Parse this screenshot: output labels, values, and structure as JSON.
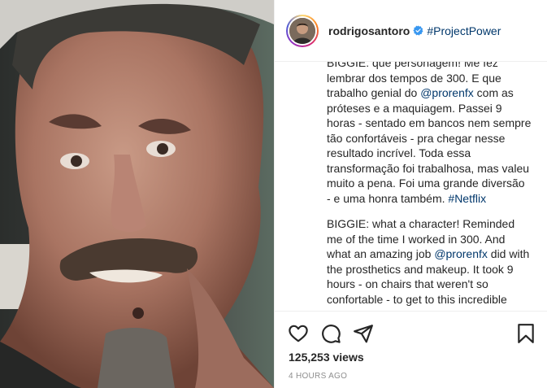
{
  "post": {
    "media_alt": "Close-up of actor in heavy prosthetic makeup",
    "username": "rodrigosantoro",
    "header_hashtag": "#ProjectPower",
    "caption_pt": {
      "t1": "BIGGIE: que personagem! Me fez lembrar dos tempos de 300. E que trabalho genial do ",
      "mention": "@prorenfx",
      "t2": " com as próteses e a maquiagem. Passei 9 horas - sentado em bancos nem sempre tão confortáveis - pra chegar nesse resultado incrível. Toda essa transformação foi trabalhosa, mas valeu muito a pena. Foi uma grande diversão - e uma honra também. ",
      "tag": "#Netflix"
    },
    "caption_en": {
      "t1": "BIGGIE: what a character! Reminded me of the time I worked in 300. And what an amazing job ",
      "mention": "@prorenfx",
      "t2": " did with the prosthetics and makeup. It took 9 hours - on chairs that weren't so confortable - to get to this incredible"
    },
    "views": "125,253 views",
    "time_ago": "4 HOURS AGO"
  },
  "icons": {
    "verified": "verified-badge-icon",
    "like": "heart-icon",
    "comment": "comment-icon",
    "share": "paper-plane-icon",
    "save": "bookmark-icon"
  },
  "colors": {
    "link": "#00376b",
    "verified": "#3897f0",
    "muted": "#8e8e8e",
    "text": "#262626"
  }
}
